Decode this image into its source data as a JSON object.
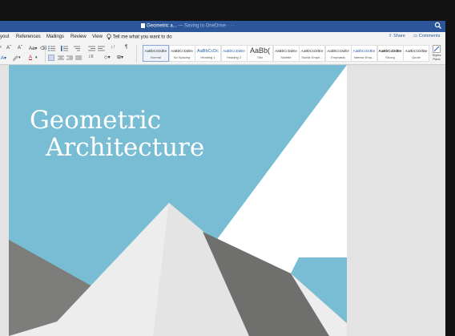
{
  "titlebar": {
    "left_fragment": "",
    "document_name": "Geometric a...",
    "save_status": " — Saving to OneDrive · · ·"
  },
  "menu": {
    "items": [
      "yout",
      "References",
      "Mailings",
      "Review",
      "View"
    ],
    "tell_me": "Tell me what you want to do",
    "share": "Share",
    "comments": "Comments"
  },
  "ribbon": {
    "font_grow": "Aˆ",
    "font_shrink": "Aˇ",
    "font_color": "A",
    "pilcrow": "¶",
    "styles": [
      {
        "sample": "AaBbCcDdEe",
        "name": "Normal",
        "active": true
      },
      {
        "sample": "AaBbCcDdEe",
        "name": "No Spacing"
      },
      {
        "sample": "AaBbCcDc",
        "name": "Heading 1"
      },
      {
        "sample": "AaBbCcDdEe",
        "name": "Heading 2"
      },
      {
        "sample": "AaBb(",
        "name": "Title"
      },
      {
        "sample": "AaBbCcDdEe",
        "name": "Subtitle"
      },
      {
        "sample": "AaBbCcDdEe",
        "name": "Subtle Emph..."
      },
      {
        "sample": "AaBbCcDdEe",
        "name": "Emphasis"
      },
      {
        "sample": "AaBbCcDdEe",
        "name": "Intense Emp..."
      },
      {
        "sample": "AaBbCcDdEe",
        "name": "Strong"
      },
      {
        "sample": "AaBbCcDdEe",
        "name": "Quote"
      }
    ],
    "styles_pane": "Styles Pane"
  },
  "document": {
    "title_line1": "Geometric",
    "title_line2": "Architecture"
  },
  "colors": {
    "titlebar": "#2b579a",
    "cover_blue": "#78bdd3",
    "pyramid_light": "#ededed",
    "pyramid_dark": "#6f6f6d",
    "ground_gray": "#7d7d7b"
  }
}
